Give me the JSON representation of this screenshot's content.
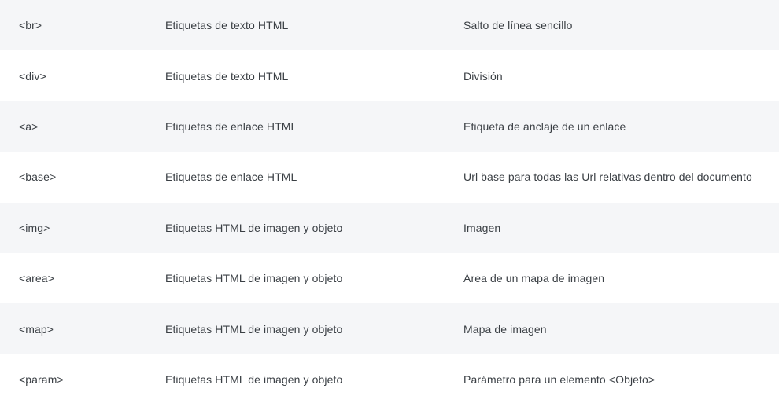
{
  "table": {
    "rows": [
      {
        "tag": "<br>",
        "category": "Etiquetas de texto HTML",
        "description": "Salto de línea sencillo"
      },
      {
        "tag": "<div>",
        "category": "Etiquetas de texto HTML",
        "description": "División"
      },
      {
        "tag": "<a>",
        "category": "Etiquetas de enlace HTML",
        "description": "Etiqueta de anclaje de un enlace"
      },
      {
        "tag": "<base>",
        "category": "Etiquetas de enlace HTML",
        "description": "Url base para todas las Url relativas dentro del documento"
      },
      {
        "tag": "<img>",
        "category": "Etiquetas HTML de imagen y objeto",
        "description": "Imagen"
      },
      {
        "tag": "<area>",
        "category": "Etiquetas HTML de imagen y objeto",
        "description": "Área de un mapa de imagen"
      },
      {
        "tag": "<map>",
        "category": "Etiquetas HTML de imagen y objeto",
        "description": "Mapa de imagen"
      },
      {
        "tag": "<param>",
        "category": "Etiquetas HTML de imagen y objeto",
        "description": "Parámetro para un elemento <Objeto>"
      }
    ]
  }
}
